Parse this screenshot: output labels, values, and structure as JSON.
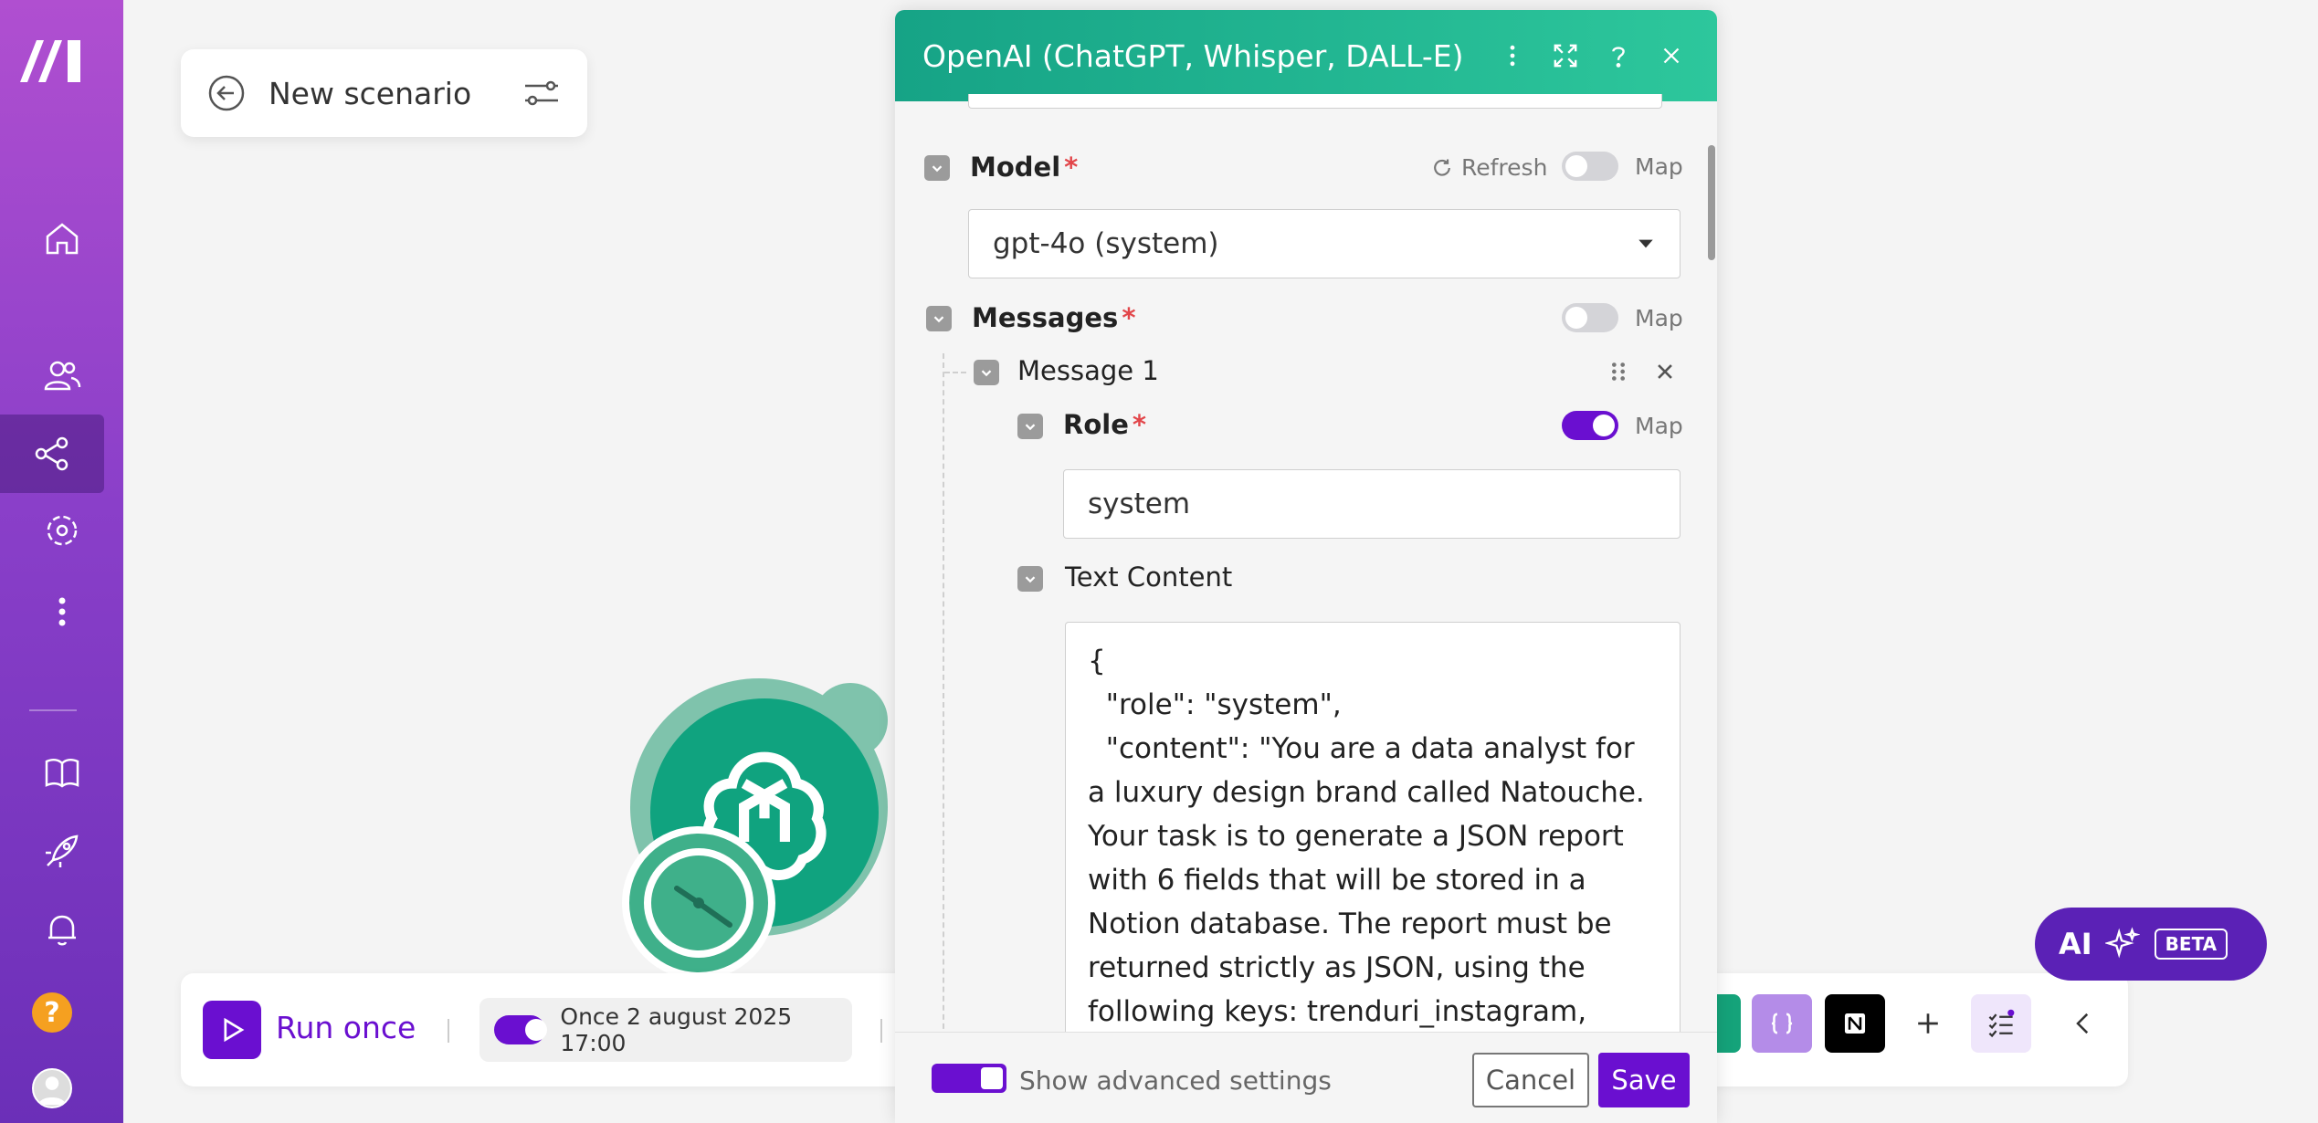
{
  "scenario": {
    "title": "New scenario"
  },
  "module": {
    "label": "OpenAI (ChatGPT, Whisper, D"
  },
  "toolbar": {
    "run_label": "Run once",
    "schedule_label": "Once 2 august 2025 17:00"
  },
  "ai_button": {
    "label": "AI",
    "badge": "BETA"
  },
  "panel": {
    "title": "OpenAI (ChatGPT, Whisper, DALL-E)",
    "model": {
      "label": "Model",
      "required": "*",
      "refresh_label": "Refresh",
      "map_label": "Map",
      "value": "gpt-4o (system)"
    },
    "messages": {
      "label": "Messages",
      "required": "*",
      "map_label": "Map",
      "message_title": "Message 1",
      "role": {
        "label": "Role",
        "required": "*",
        "map_label": "Map",
        "value": "system"
      },
      "text_content": {
        "label": "Text Content",
        "value": "{\n  \"role\": \"system\",\n  \"content\": \"You are a data analyst for a luxury design brand called Natouche. Your task is to generate a JSON report with 6 fields that will be stored in a Notion database. The report must be returned strictly as JSON, using the following keys: trenduri_instagram,"
      }
    },
    "footer": {
      "advanced_label": "Show advanced settings",
      "cancel_label": "Cancel",
      "save_label": "Save"
    }
  },
  "colors": {
    "accent": "#6a0fd0",
    "header_start": "#16a386",
    "header_end": "#2dc79c",
    "required": "#e2464a"
  }
}
